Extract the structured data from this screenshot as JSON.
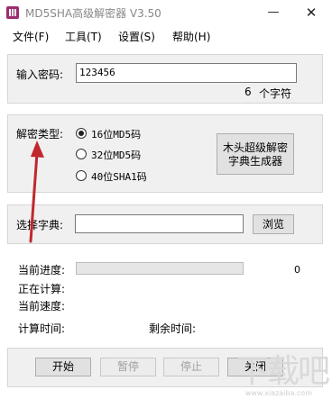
{
  "window": {
    "title": "MD5SHA高级解密器 V3.50",
    "minimize_glyph": "—",
    "close_glyph": "✕"
  },
  "menu": {
    "file": "文件(F)",
    "tools": "工具(T)",
    "settings": "设置(S)",
    "help": "帮助(H)"
  },
  "password": {
    "label": "输入密码:",
    "value": "123456",
    "length_count": "6",
    "length_unit": "个字符"
  },
  "decrypt": {
    "label": "解密类型:",
    "options": [
      "16位MD5码",
      "32位MD5码",
      "40位SHA1码"
    ],
    "selected_index": 0,
    "generator_button_line1": "木头超级解密",
    "generator_button_line2": "字典生成器"
  },
  "dictionary": {
    "label": "选择字典:",
    "value": "",
    "browse_button": "浏览"
  },
  "status": {
    "progress_label": "当前进度:",
    "progress_value": "0",
    "progress_fraction": 0,
    "calculating_label": "正在计算:",
    "speed_label": "当前速度:",
    "calc_time_label": "计算时间:",
    "remaining_time_label": "剩余时间:"
  },
  "actions": {
    "start": "开始",
    "pause": "暂停",
    "stop": "停止",
    "close": "关闭"
  },
  "watermark": {
    "text": "下载吧",
    "url": "www.xiazaiba.com"
  },
  "colors": {
    "arrow": "#c0282d",
    "progress_fill": "#06b025"
  }
}
